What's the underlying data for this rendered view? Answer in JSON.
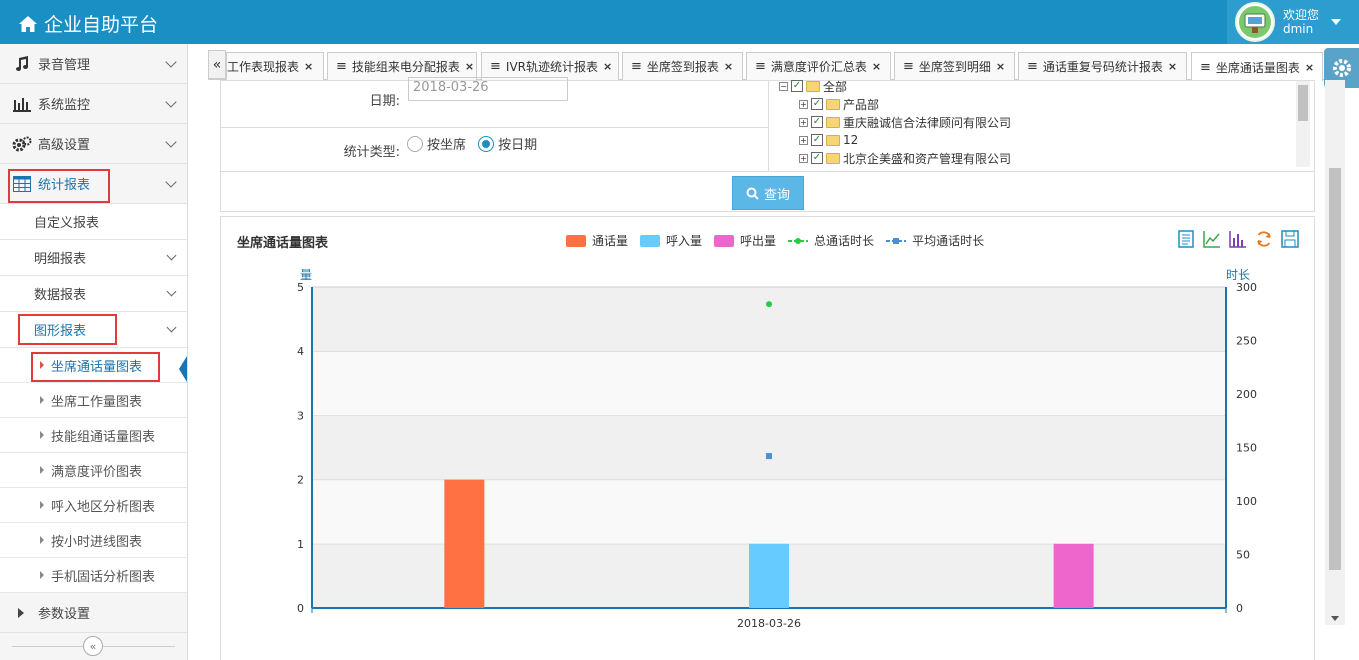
{
  "header": {
    "title": "企业自助平台",
    "welcome": "欢迎您",
    "username": "dmin"
  },
  "sidebar": {
    "items": [
      {
        "label": "录音管理",
        "icon": "music-icon"
      },
      {
        "label": "系统监控",
        "icon": "bar-chart-icon"
      },
      {
        "label": "高级设置",
        "icon": "gears-icon"
      },
      {
        "label": "统计报表",
        "icon": "table-icon"
      }
    ],
    "sub_items": [
      {
        "label": "自定义报表"
      },
      {
        "label": "明细报表"
      },
      {
        "label": "数据报表"
      },
      {
        "label": "图形报表"
      }
    ],
    "leaves": [
      {
        "label": "坐席通话量图表"
      },
      {
        "label": "坐席工作量图表"
      },
      {
        "label": "技能组通话量图表"
      },
      {
        "label": "满意度评价图表"
      },
      {
        "label": "呼入地区分析图表"
      },
      {
        "label": "按小时进线图表"
      },
      {
        "label": "手机固话分析图表"
      }
    ],
    "footer_item": {
      "label": "参数设置"
    },
    "collapse_glyph": "«"
  },
  "tabs": {
    "prev_glyph": "«",
    "next_glyph": "»",
    "items": [
      {
        "label": "工作表现报表"
      },
      {
        "label": "技能组来电分配报表"
      },
      {
        "label": "IVR轨迹统计报表"
      },
      {
        "label": "坐席签到报表"
      },
      {
        "label": "满意度评价汇总表"
      },
      {
        "label": "坐席签到明细"
      },
      {
        "label": "通话重复号码统计报表"
      },
      {
        "label": "坐席通话量图表"
      }
    ],
    "close_glyph": "×",
    "menu_glyph": "≡"
  },
  "form": {
    "date_label": "日期:",
    "date_value": "2018-03-26",
    "type_label": "统计类型:",
    "radio_agent": "按坐席",
    "radio_date": "按日期",
    "tree": [
      {
        "label": "全部"
      },
      {
        "label": "产品部"
      },
      {
        "label": "重庆融诚信合法律顾问有限公司"
      },
      {
        "label": "12"
      },
      {
        "label": "北京企美盛和资产管理有限公司"
      }
    ],
    "query_label": "查询"
  },
  "chart_data": {
    "type": "bar",
    "title": "坐席通话量图表",
    "categories": [
      "2018-03-26"
    ],
    "series": [
      {
        "name": "通话量",
        "kind": "bar",
        "axis": "left",
        "values": [
          2
        ],
        "color": "#ff7043"
      },
      {
        "name": "呼入量",
        "kind": "bar",
        "axis": "left",
        "values": [
          1
        ],
        "color": "#66ccff"
      },
      {
        "name": "呼出量",
        "kind": "bar",
        "axis": "left",
        "values": [
          1
        ],
        "color": "#ee66cc"
      },
      {
        "name": "总通话时长",
        "kind": "line",
        "axis": "right",
        "values": [
          284
        ],
        "color": "#22cc44"
      },
      {
        "name": "平均通话时长",
        "kind": "line",
        "axis": "right",
        "values": [
          142
        ],
        "color": "#4a90d9"
      }
    ],
    "ylabel": "量",
    "y2label": "时长",
    "ylim": [
      0,
      5
    ],
    "y2lim": [
      0,
      300
    ],
    "yticks": [
      0,
      1,
      2,
      3,
      4,
      5
    ],
    "y2ticks": [
      0,
      50,
      100,
      150,
      200,
      250,
      300
    ],
    "legend_position": "top",
    "grid": true
  }
}
